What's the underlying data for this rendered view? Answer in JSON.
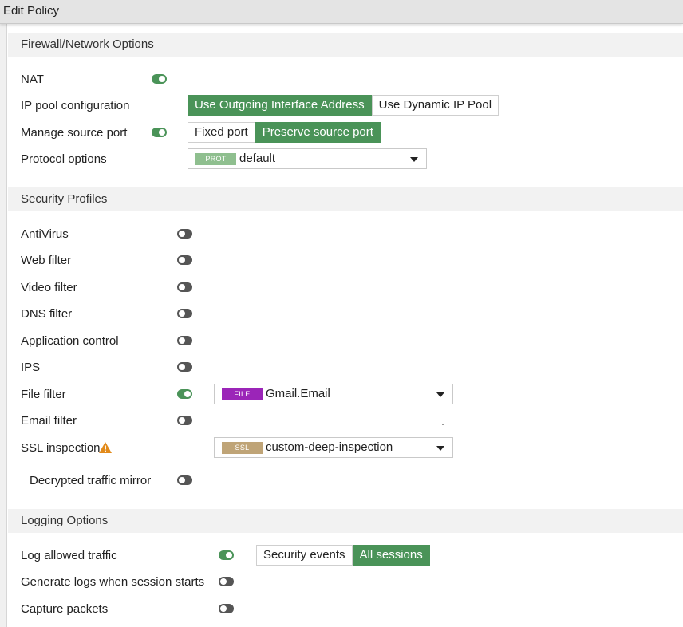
{
  "window": {
    "title": "Edit Policy"
  },
  "firewall": {
    "header": "Firewall/Network Options",
    "nat_label": "NAT",
    "nat_enabled": true,
    "ip_pool_label": "IP pool configuration",
    "ip_pool_options": [
      "Use Outgoing Interface Address",
      "Use Dynamic IP Pool"
    ],
    "ip_pool_selected": "Use Outgoing Interface Address",
    "source_port_label": "Manage source port",
    "source_port_enabled": true,
    "source_port_options": [
      "Fixed port",
      "Preserve source port"
    ],
    "source_port_selected": "Preserve source port",
    "protocol_label": "Protocol options",
    "protocol_badge": "PROT",
    "protocol_value": "default"
  },
  "security": {
    "header": "Security Profiles",
    "antivirus": "AntiVirus",
    "web_filter": "Web filter",
    "video_filter": "Video filter",
    "dns_filter": "DNS filter",
    "app_control": "Application control",
    "ips": "IPS",
    "file_filter": "File filter",
    "file_filter_badge": "FILE",
    "file_filter_value": "Gmail.Email",
    "email_filter": "Email filter",
    "ssl_inspection": "SSL inspection",
    "ssl_badge": "SSL",
    "ssl_value": "custom-deep-inspection",
    "decrypted_mirror": "Decrypted traffic mirror",
    "toggles": {
      "antivirus": false,
      "web_filter": false,
      "video_filter": false,
      "dns_filter": false,
      "app_control": false,
      "ips": false,
      "file_filter": true,
      "email_filter": false,
      "decrypted_mirror": false
    }
  },
  "logging": {
    "header": "Logging Options",
    "log_allowed_label": "Log allowed traffic",
    "log_allowed_enabled": true,
    "log_options": [
      "Security events",
      "All sessions"
    ],
    "log_selected": "All sessions",
    "session_start_label": "Generate logs when session starts",
    "session_start_enabled": false,
    "capture_packets_label": "Capture packets",
    "capture_packets_enabled": false
  },
  "colors": {
    "accent_green": "#4a9358",
    "toggle_off": "#555555",
    "prot_badge": "#8fbf8f",
    "file_badge": "#9b25b8",
    "ssl_badge": "#bfa477",
    "warning": "#e28a1a"
  },
  "icons": {
    "ssl_warning": "warning-triangle-icon",
    "dropdown": "caret-down-icon"
  }
}
